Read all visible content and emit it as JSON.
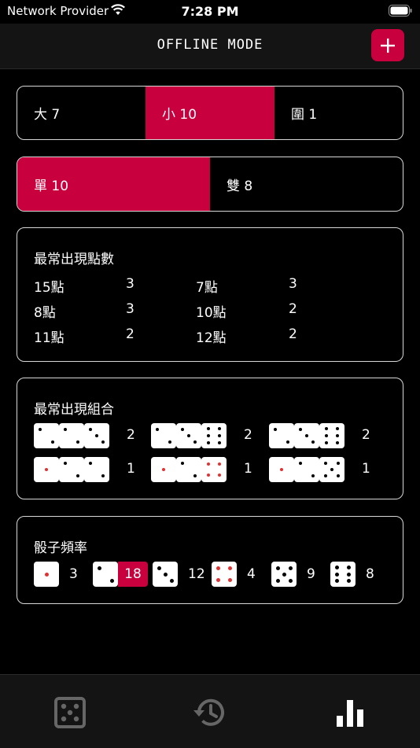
{
  "status": {
    "carrier": "Network Provider",
    "time": "7:28 PM"
  },
  "nav": {
    "title": "OFFLINE MODE",
    "add_icon": "plus-icon"
  },
  "big_small": [
    {
      "label": "大 7",
      "active": false
    },
    {
      "label": "小 10",
      "active": true
    },
    {
      "label": "圍 1",
      "active": false
    }
  ],
  "odd_even": [
    {
      "label": "單 10",
      "active": true
    },
    {
      "label": "雙 8",
      "active": false
    }
  ],
  "frequent_sums": {
    "title": "最常出現點數",
    "rows": [
      {
        "label": "15點",
        "count": "3"
      },
      {
        "label": "7點",
        "count": "3"
      },
      {
        "label": "8點",
        "count": "3"
      },
      {
        "label": "10點",
        "count": "2"
      },
      {
        "label": "11點",
        "count": "2"
      },
      {
        "label": "12點",
        "count": "2"
      }
    ]
  },
  "frequent_combos": {
    "title": "最常出現組合",
    "combos": [
      {
        "dice": [
          2,
          2,
          3
        ],
        "count": "2"
      },
      {
        "dice": [
          2,
          3,
          6
        ],
        "count": "2"
      },
      {
        "dice": [
          2,
          3,
          6
        ],
        "count": "2"
      },
      {
        "dice": [
          1,
          2,
          2
        ],
        "count": "1"
      },
      {
        "dice": [
          1,
          2,
          4
        ],
        "count": "1"
      },
      {
        "dice": [
          1,
          2,
          5
        ],
        "count": "1"
      }
    ]
  },
  "dice_frequency": {
    "title": "骰子頻率",
    "items": [
      {
        "face": 1,
        "count": "3",
        "highlight": false
      },
      {
        "face": 2,
        "count": "18",
        "highlight": true
      },
      {
        "face": 3,
        "count": "12",
        "highlight": false
      },
      {
        "face": 4,
        "count": "4",
        "highlight": false
      },
      {
        "face": 5,
        "count": "9",
        "highlight": false
      },
      {
        "face": 6,
        "count": "8",
        "highlight": false
      }
    ]
  },
  "tabs": [
    {
      "name": "dice",
      "icon": "dice-icon"
    },
    {
      "name": "history",
      "icon": "history-icon"
    },
    {
      "name": "stats",
      "icon": "bar-chart-icon"
    }
  ],
  "colors": {
    "accent": "#c8003e",
    "pip_red": "#e03232"
  }
}
